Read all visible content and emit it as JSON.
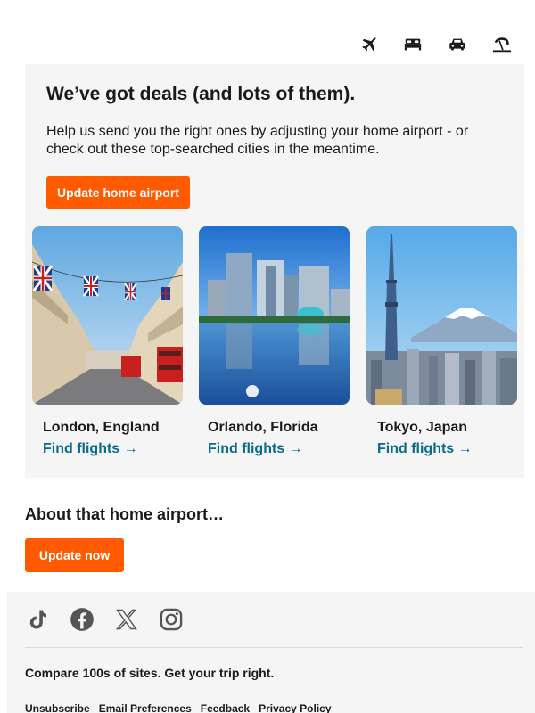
{
  "nav": {
    "icons": [
      "plane-icon",
      "bed-icon",
      "car-icon",
      "beach-umbrella-icon"
    ]
  },
  "deals": {
    "headline": "We’ve got deals (and lots of them).",
    "body": "Help us send you the right ones by adjusting your home airport - or check out these top-searched cities in the meantime.",
    "button_label": "Update home airport"
  },
  "cards": [
    {
      "city": "London, England",
      "link": "Find flights →"
    },
    {
      "city": "Orlando, Florida",
      "link": "Find flights →"
    },
    {
      "city": "Tokyo, Japan",
      "link": "Find flights →"
    }
  ],
  "about": {
    "heading": "About that home airport…",
    "button_label": "Update now"
  },
  "footer": {
    "social": [
      "tiktok-icon",
      "facebook-icon",
      "x-icon",
      "instagram-icon"
    ],
    "tagline": "Compare 100s of sites. Get your trip right.",
    "links": [
      "Unsubscribe",
      "Email Preferences",
      "Feedback",
      "Privacy Policy"
    ]
  },
  "colors": {
    "accent": "#ff5a00",
    "link": "#0a6b8a",
    "panel": "#f5f5f5"
  }
}
